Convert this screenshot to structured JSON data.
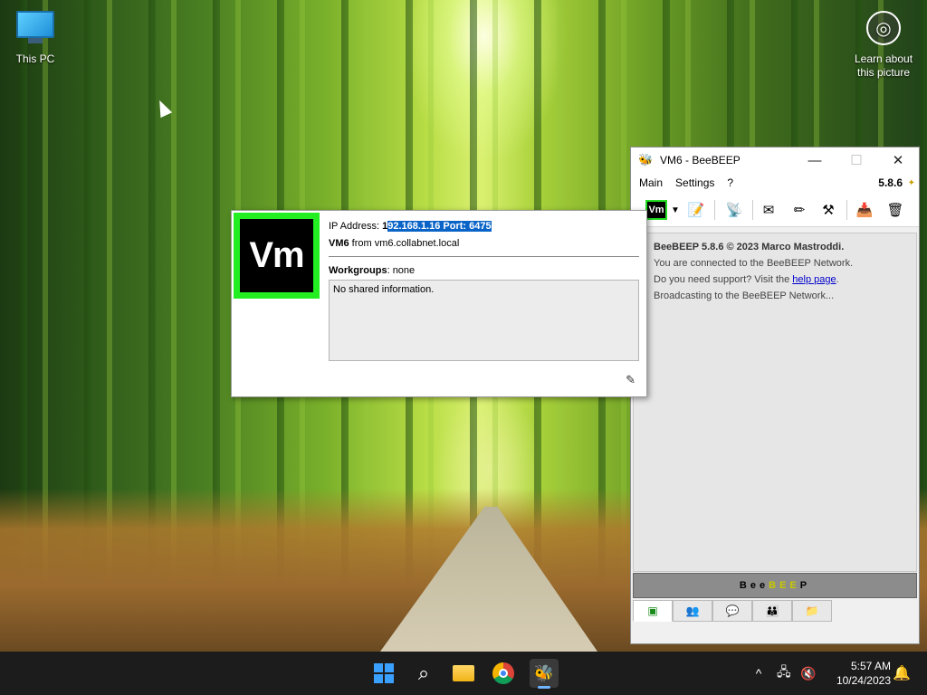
{
  "desktop": {
    "icons": [
      {
        "label": "This PC"
      },
      {
        "label_line1": "Learn about",
        "label_line2": "this picture"
      }
    ]
  },
  "beebeep": {
    "title": "VM6 - BeeBEEP",
    "window_controls": {
      "minimize": "—",
      "maximize": "☐",
      "close": "✕"
    },
    "menu": [
      "Main",
      "Settings",
      "?"
    ],
    "version": "5.8.6",
    "toolbar": {
      "user_avatar": "Vm",
      "dropdown": "▼"
    },
    "chat": {
      "line1": "BeeBEEP 5.8.6 © 2023 Marco Mastroddi.",
      "line2": "You are connected to the BeeBEEP Network.",
      "line3_prefix": "Do you need support? Visit the ",
      "line3_link": "help page",
      "line3_suffix": ".",
      "line4": "Broadcasting to the BeeBEEP Network..."
    },
    "bee_bar": [
      "B",
      "e",
      "e",
      "B",
      "E",
      "E",
      "P"
    ]
  },
  "popup": {
    "avatar": "Vm",
    "ip_label": "IP Address: ",
    "ip_first_char": "1",
    "ip_selected": "92.168.1.16   Port: 6475",
    "user_name": "VM6",
    "user_from": " from vm6.collabnet.local",
    "workgroups_label": "Workgroups",
    "workgroups_value": ": none",
    "shared_info": "No shared information."
  },
  "taskbar": {
    "time": "5:57 AM",
    "date": "10/24/2023",
    "tray_chevron": "^"
  }
}
